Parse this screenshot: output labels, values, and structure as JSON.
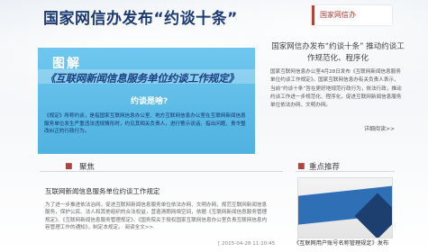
{
  "header": {
    "headline": "国家网信办发布“约谈十条”",
    "channel_label": "国家网信办"
  },
  "banner": {
    "tag": "图解",
    "title": "《互联网新闻信息服务单位约谈工作规定》",
    "subtitle": "约谈是啥?",
    "paragraph": "《规定》所称约谈，是指国家互联网信息办公室、地方互联网信息办公室在互联网新闻信息服务单位发生严重违法违规情形时，约见其相关负责人，进行警示谈话、指出问题、责令整改纠正的行政行为。"
  },
  "side": {
    "title": "国家网信办发布“约谈十条” 推动约谈工作规范化、程序化",
    "body": "国家互联网信息办公室4月28日发布《互联网新闻信息服务单位约谈工作规定》。国家互联网信息办有关负责人表示，当前“约谈十条”旨在更好地规范行政行为，依法行政，推动约谈工作进一步规范化、程序化，促进互联网新闻信息服务单位依法办网、文明办网。",
    "more": "详细阅读>>"
  },
  "sections": {
    "focus_label": "聚焦",
    "featured_label": "重点推荐"
  },
  "news": {
    "title": "互联网新闻信息服务单位约谈工作规定",
    "body": "为了进一步推进依法治网，促进互联网新闻信息服务单位依法办网、文明办网，规范互联网新闻信息服务，保护公民、法人和其他组织的合法权益，营造清朗网络空间，依据《互联网新闻信息服务管理规定》、《互联网新闻信息服务管理规定》、《国务院关于授权国家互联网信息办公室负责互联网信息内容管理工作的通知》，制定本规定。 阅读全文>>",
    "date": "[ 2015-04-28 11:10:45"
  },
  "featured": {
    "caption": "《互联网用户账号名称管理规定》发布"
  }
}
